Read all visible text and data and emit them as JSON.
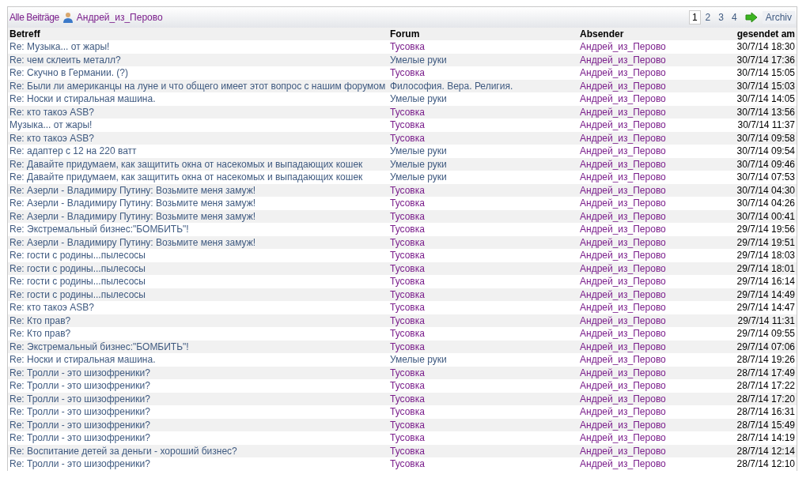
{
  "toolbar": {
    "all_posts_link": "Alle Beiträge",
    "user_link": "Андрей_из_Перово",
    "pages": [
      {
        "label": "1",
        "selected": true
      },
      {
        "label": "2",
        "selected": false
      },
      {
        "label": "3",
        "selected": false
      },
      {
        "label": "4",
        "selected": false
      }
    ],
    "archive_link": "Archiv"
  },
  "table": {
    "columns": [
      "Betreff",
      "Forum",
      "Absender",
      "gesendet am"
    ],
    "rows": [
      {
        "subject": "Re: Музыка... от жары!",
        "forum": "Тусовка",
        "forum_visited": true,
        "sender": "Андрей_из_Перово",
        "sent": "30/7/14 18:30"
      },
      {
        "subject": "Re: чем склеить металл?",
        "forum": "Умелые руки",
        "forum_visited": false,
        "sender": "Андрей_из_Перово",
        "sent": "30/7/14 17:36"
      },
      {
        "subject": "Re: Скучно в Германии. (?)",
        "forum": "Тусовка",
        "forum_visited": true,
        "sender": "Андрей_из_Перово",
        "sent": "30/7/14 15:05"
      },
      {
        "subject": "Re: Были ли американцы на луне и что общего имеет этот вопрос с нашим форумом",
        "forum": "Философия. Вера. Религия.",
        "forum_visited": false,
        "sender": "Андрей_из_Перово",
        "sent": "30/7/14 15:03"
      },
      {
        "subject": "Re: Носки и стиральная машина.",
        "forum": "Умелые руки",
        "forum_visited": false,
        "sender": "Андрей_из_Перово",
        "sent": "30/7/14 14:05"
      },
      {
        "subject": "Re: кто такоэ ASB?",
        "forum": "Тусовка",
        "forum_visited": true,
        "sender": "Андрей_из_Перово",
        "sent": "30/7/14 13:56"
      },
      {
        "subject": "Музыка... от жары!",
        "forum": "Тусовка",
        "forum_visited": true,
        "sender": "Андрей_из_Перово",
        "sent": "30/7/14 11:37"
      },
      {
        "subject": "Re: кто такоэ ASB?",
        "forum": "Тусовка",
        "forum_visited": true,
        "sender": "Андрей_из_Перово",
        "sent": "30/7/14 09:58"
      },
      {
        "subject": "Re: адаптер с 12 на 220 ватт",
        "forum": "Умелые руки",
        "forum_visited": false,
        "sender": "Андрей_из_Перово",
        "sent": "30/7/14 09:54"
      },
      {
        "subject": "Re: Давайте придумаем, как защитить окна от насекомых и выпадающих кошек",
        "forum": "Умелые руки",
        "forum_visited": false,
        "sender": "Андрей_из_Перово",
        "sent": "30/7/14 09:46"
      },
      {
        "subject": "Re: Давайте придумаем, как защитить окна от насекомых и выпадающих кошек",
        "forum": "Умелые руки",
        "forum_visited": false,
        "sender": "Андрей_из_Перово",
        "sent": "30/7/14 07:53"
      },
      {
        "subject": "Re: Азерли - Владимиру Путину: Возьмите меня замуж!",
        "forum": "Тусовка",
        "forum_visited": true,
        "sender": "Андрей_из_Перово",
        "sent": "30/7/14 04:30"
      },
      {
        "subject": "Re: Азерли - Владимиру Путину: Возьмите меня замуж!",
        "forum": "Тусовка",
        "forum_visited": true,
        "sender": "Андрей_из_Перово",
        "sent": "30/7/14 04:26"
      },
      {
        "subject": "Re: Азерли - Владимиру Путину: Возьмите меня замуж!",
        "forum": "Тусовка",
        "forum_visited": true,
        "sender": "Андрей_из_Перово",
        "sent": "30/7/14 00:41"
      },
      {
        "subject": "Re: Экстремальный бизнес:\"БОМБИТЬ\"!",
        "forum": "Тусовка",
        "forum_visited": true,
        "sender": "Андрей_из_Перово",
        "sent": "29/7/14 19:56"
      },
      {
        "subject": "Re: Азерли - Владимиру Путину: Возьмите меня замуж!",
        "forum": "Тусовка",
        "forum_visited": true,
        "sender": "Андрей_из_Перово",
        "sent": "29/7/14 19:51"
      },
      {
        "subject": "Re: гости с родины...пылесосы",
        "forum": "Тусовка",
        "forum_visited": true,
        "sender": "Андрей_из_Перово",
        "sent": "29/7/14 18:03"
      },
      {
        "subject": "Re: гости с родины...пылесосы",
        "forum": "Тусовка",
        "forum_visited": true,
        "sender": "Андрей_из_Перово",
        "sent": "29/7/14 18:01"
      },
      {
        "subject": "Re: гости с родины...пылесосы",
        "forum": "Тусовка",
        "forum_visited": true,
        "sender": "Андрей_из_Перово",
        "sent": "29/7/14 16:14"
      },
      {
        "subject": "Re: гости с родины...пылесосы",
        "forum": "Тусовка",
        "forum_visited": true,
        "sender": "Андрей_из_Перово",
        "sent": "29/7/14 14:49"
      },
      {
        "subject": "Re: кто такоэ ASB?",
        "forum": "Тусовка",
        "forum_visited": true,
        "sender": "Андрей_из_Перово",
        "sent": "29/7/14 14:47"
      },
      {
        "subject": "Re: Кто прав?",
        "forum": "Тусовка",
        "forum_visited": true,
        "sender": "Андрей_из_Перово",
        "sent": "29/7/14 11:31"
      },
      {
        "subject": "Re: Кто прав?",
        "forum": "Тусовка",
        "forum_visited": true,
        "sender": "Андрей_из_Перово",
        "sent": "29/7/14 09:55"
      },
      {
        "subject": "Re: Экстремальный бизнес:\"БОМБИТЬ\"!",
        "forum": "Тусовка",
        "forum_visited": true,
        "sender": "Андрей_из_Перово",
        "sent": "29/7/14 07:06"
      },
      {
        "subject": "Re: Носки и стиральная машина.",
        "forum": "Умелые руки",
        "forum_visited": false,
        "sender": "Андрей_из_Перово",
        "sent": "28/7/14 19:26"
      },
      {
        "subject": "Re: Тролли - это шизофреники?",
        "forum": "Тусовка",
        "forum_visited": true,
        "sender": "Андрей_из_Перово",
        "sent": "28/7/14 17:49"
      },
      {
        "subject": "Re: Тролли - это шизофреники?",
        "forum": "Тусовка",
        "forum_visited": true,
        "sender": "Андрей_из_Перово",
        "sent": "28/7/14 17:22"
      },
      {
        "subject": "Re: Тролли - это шизофреники?",
        "forum": "Тусовка",
        "forum_visited": true,
        "sender": "Андрей_из_Перово",
        "sent": "28/7/14 17:20"
      },
      {
        "subject": "Re: Тролли - это шизофреники?",
        "forum": "Тусовка",
        "forum_visited": true,
        "sender": "Андрей_из_Перово",
        "sent": "28/7/14 16:31"
      },
      {
        "subject": "Re: Тролли - это шизофреники?",
        "forum": "Тусовка",
        "forum_visited": true,
        "sender": "Андрей_из_Перово",
        "sent": "28/7/14 15:49"
      },
      {
        "subject": "Re: Тролли - это шизофреники?",
        "forum": "Тусовка",
        "forum_visited": true,
        "sender": "Андрей_из_Перово",
        "sent": "28/7/14 14:19"
      },
      {
        "subject": "Re: Воспитание детей за деньги - хороший бизнес?",
        "forum": "Тусовка",
        "forum_visited": true,
        "sender": "Андрей_из_Перово",
        "sent": "28/7/14 12:14"
      },
      {
        "subject": "Re: Тролли - это шизофреники?",
        "forum": "Тусовка",
        "forum_visited": true,
        "sender": "Андрей_из_Перово",
        "sent": "28/7/14 12:10"
      }
    ]
  }
}
